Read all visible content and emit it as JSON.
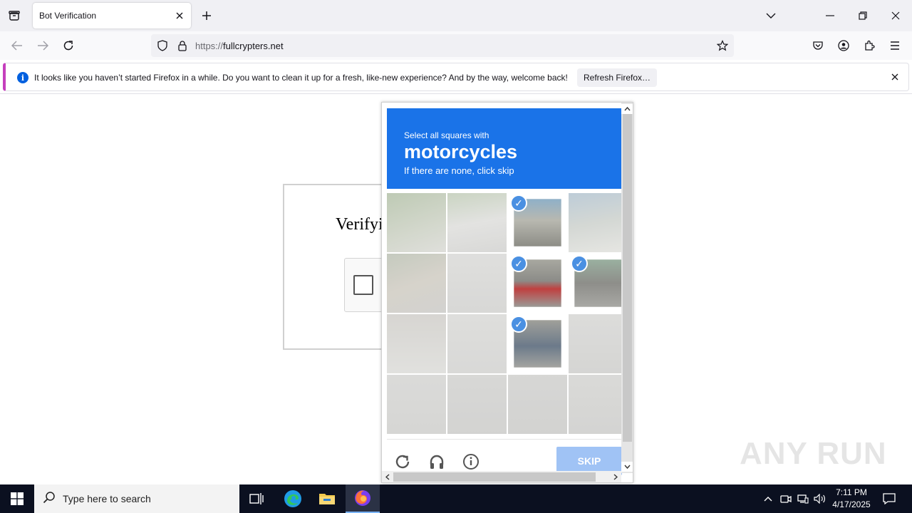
{
  "browser": {
    "tab_title": "Bot Verification",
    "url_scheme": "https://",
    "url_host": "fullcrypters.net"
  },
  "notification": {
    "message": "It looks like you haven’t started Firefox in a while. Do you want to clean it up for a fresh, like-new experience? And by the way, welcome back!",
    "button_label": "Refresh Firefox…"
  },
  "page": {
    "verify_title": "Verifyi"
  },
  "captcha": {
    "instruction_small": "Select all squares with",
    "target": "motorcycles",
    "instruction_sub": "If there are none, click skip",
    "skip_label": "SKIP",
    "selected_tiles": [
      2,
      6,
      7,
      10
    ],
    "header_color": "#1a73e8"
  },
  "watermark": "ANY RUN",
  "taskbar": {
    "search_placeholder": "Type here to search",
    "time": "7:11 PM",
    "date": "4/17/2025"
  }
}
